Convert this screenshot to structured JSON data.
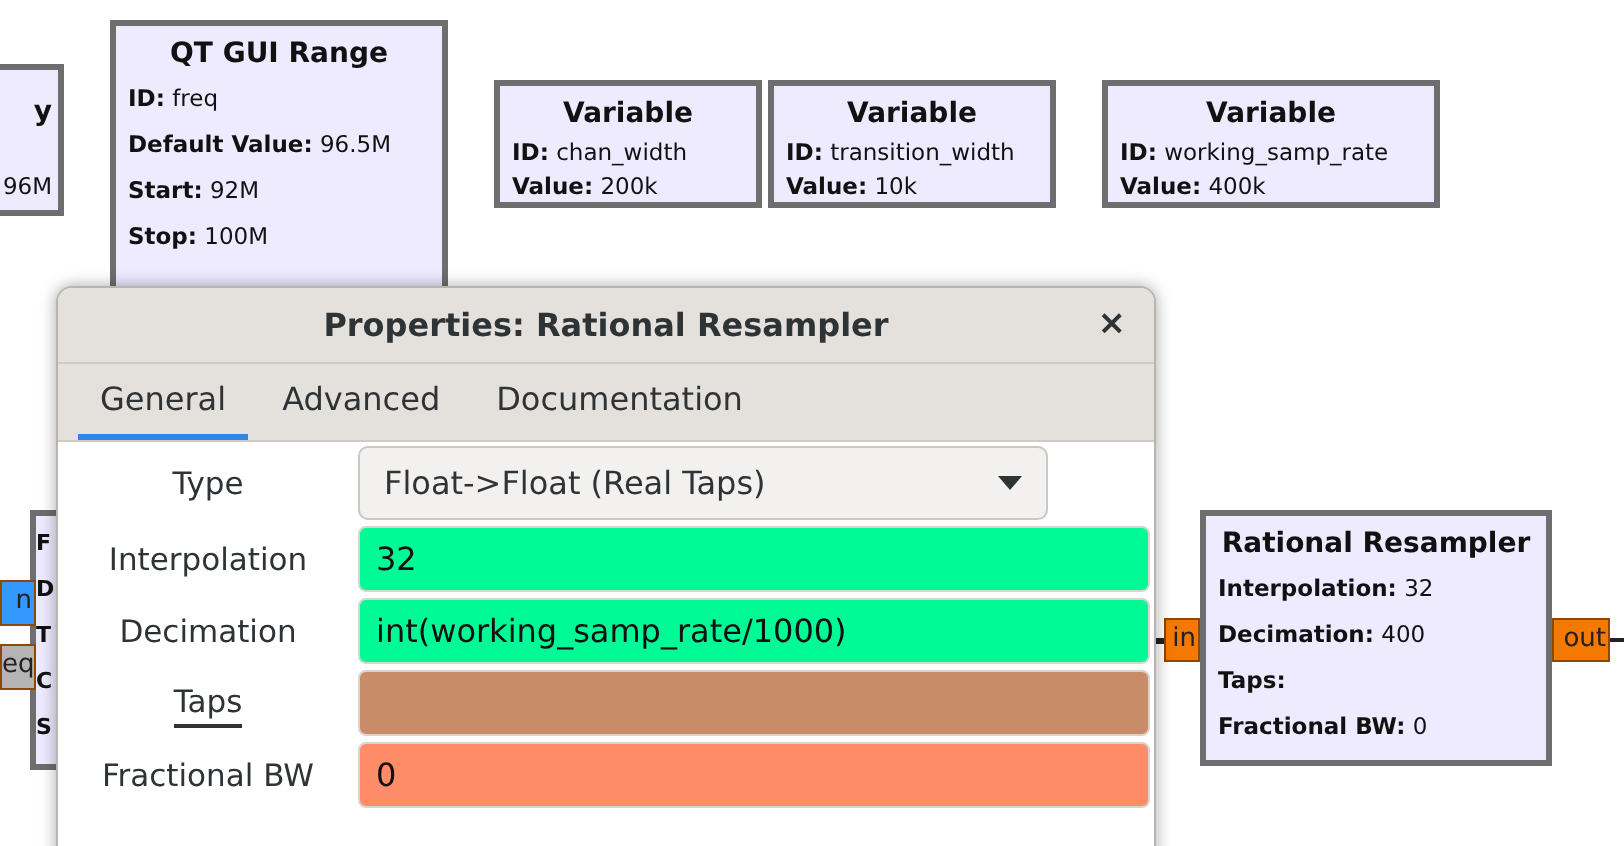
{
  "blocks": [
    {
      "title": "y",
      "lines": [
        {
          "value": "96M"
        }
      ]
    },
    {
      "title": "QT GUI Range",
      "lines": [
        {
          "key": "ID:",
          "value": "freq"
        },
        {
          "key": "Default Value:",
          "value": "96.5M"
        },
        {
          "key": "Start:",
          "value": "92M"
        },
        {
          "key": "Stop:",
          "value": "100M"
        }
      ]
    },
    {
      "title": "Variable",
      "lines": [
        {
          "key": "ID:",
          "value": "chan_width"
        },
        {
          "key": "Value:",
          "value": "200k"
        }
      ]
    },
    {
      "title": "Variable",
      "lines": [
        {
          "key": "ID:",
          "value": "transition_width"
        },
        {
          "key": "Value:",
          "value": "10k"
        }
      ]
    },
    {
      "title": "Variable",
      "lines": [
        {
          "key": "ID:",
          "value": "working_samp_rate"
        },
        {
          "key": "Value:",
          "value": "400k"
        }
      ]
    },
    {
      "lines": [
        {
          "key": "F"
        },
        {
          "key": "D"
        },
        {
          "key": "T"
        },
        {
          "key": "C"
        },
        {
          "key": "S"
        }
      ]
    },
    {
      "title": "Rational Resampler",
      "lines": [
        {
          "key": "Interpolation:",
          "value": "32"
        },
        {
          "key": "Decimation:",
          "value": "400"
        },
        {
          "key": "Taps:"
        },
        {
          "key": "Fractional BW:",
          "value": "0"
        }
      ]
    }
  ],
  "ports": [
    {
      "label": "n",
      "color": "#3399ff"
    },
    {
      "label": "eq",
      "color": "#b4b4b4"
    },
    {
      "label": "in",
      "color": "#f57900"
    },
    {
      "label": "out",
      "color": "#f57900"
    }
  ],
  "dialog": {
    "title": "Properties: Rational Resampler",
    "close": "×",
    "tabs": [
      {
        "label": "General",
        "selected": true
      },
      {
        "label": "Advanced",
        "selected": false
      },
      {
        "label": "Documentation",
        "selected": false
      }
    ],
    "params": [
      {
        "kind": "dropdown",
        "label": "Type",
        "value": "Float->Float (Real Taps)",
        "underlined": false
      },
      {
        "kind": "field",
        "label": "Interpolation",
        "value": "32",
        "color": "#00fa96",
        "underlined": false
      },
      {
        "kind": "field",
        "label": "Decimation",
        "value": "int(working_samp_rate/1000)",
        "color": "#00fa96",
        "underlined": false
      },
      {
        "kind": "field",
        "label": "Taps",
        "color": "#c98c69",
        "underlined": true
      },
      {
        "kind": "field",
        "label": "Fractional BW",
        "value": "0",
        "color": "#ff8c69",
        "underlined": false
      }
    ]
  }
}
